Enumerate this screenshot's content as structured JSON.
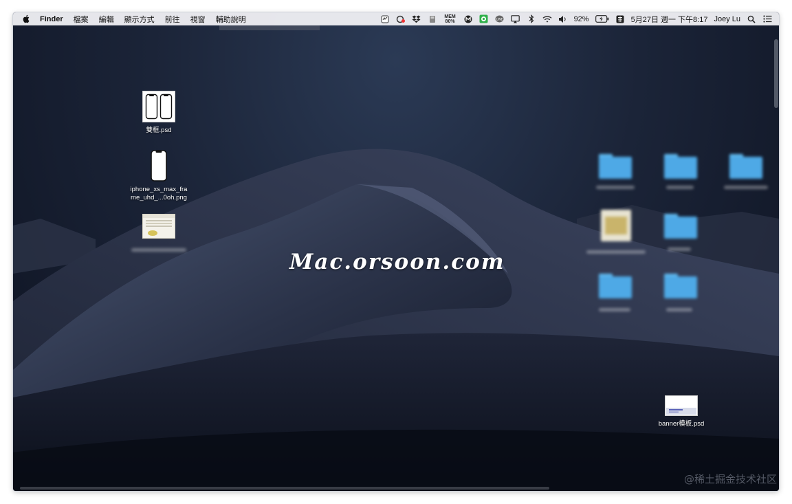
{
  "menubar": {
    "app_name": "Finder",
    "menus": [
      "檔案",
      "編輯",
      "顯示方式",
      "前往",
      "視窗",
      "輔助說明"
    ],
    "status": {
      "memory_label": "MEM",
      "memory_value": "80%",
      "battery": "92%",
      "datetime": "5月27日 週一 下午8:17",
      "user": "Joey Lu"
    },
    "icons": [
      "apple-icon",
      "notes-icon",
      "cloud-sync-icon",
      "dropbox-icon",
      "sd-card-icon",
      "memory-icon",
      "m-circle-icon",
      "evernote-icon",
      "line-icon",
      "airplay-icon",
      "bluetooth-icon",
      "wifi-icon",
      "volume-icon",
      "battery-charging-icon",
      "input-method-icon",
      "spotlight-search-icon",
      "notification-center-icon"
    ]
  },
  "desktop": {
    "files": [
      {
        "label": "雙框.psd"
      },
      {
        "label_line1": "iphone_xs_max_fra",
        "label_line2": "me_uhd_...0oh.png"
      },
      {
        "label": "banner模板.psd"
      }
    ]
  },
  "watermark": "Mac.orsoon.com",
  "site_mark": "@稀土掘金技术社区",
  "colors": {
    "menubar_bg": "#eeeef2",
    "folder_blue": "#4ea9e6",
    "desktop_bg": "#1b2438"
  }
}
